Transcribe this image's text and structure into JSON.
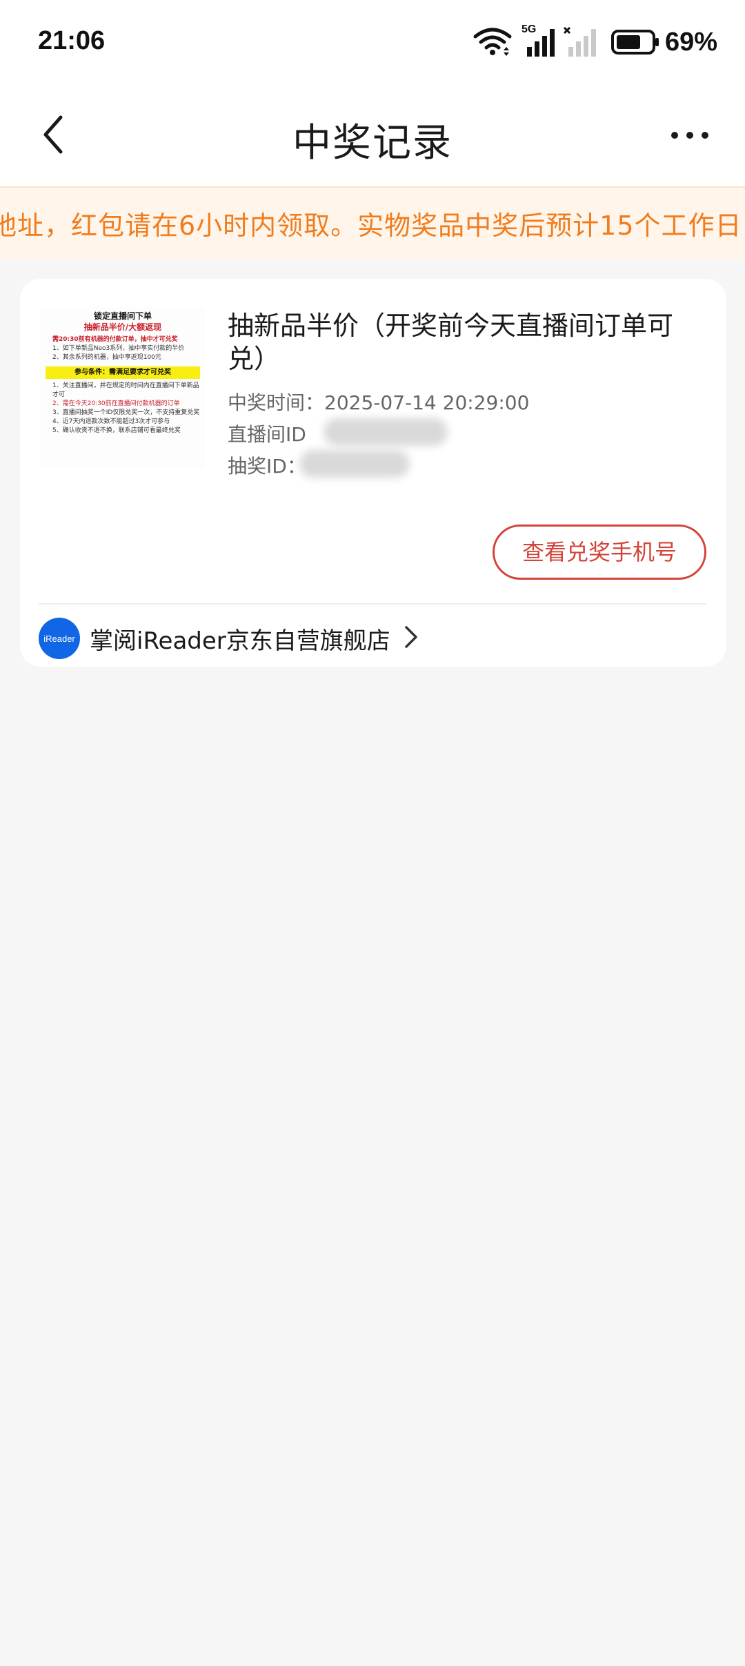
{
  "status_bar": {
    "time": "21:06",
    "battery_percent": "69%",
    "network_label": "5G",
    "icons": [
      "wifi-icon",
      "signal-5g-icon",
      "signal-no-service-icon",
      "battery-icon"
    ]
  },
  "navbar": {
    "title": "中奖记录",
    "back_icon": "chevron-left-icon",
    "more_icon": "more-dots-icon"
  },
  "notice": {
    "text": "地址，红包请在6小时内领取。实物奖品中奖后预计15个工作日"
  },
  "prize_card": {
    "thumbnail": {
      "title": "锁定直播间下单",
      "subtitle": "抽新品半价/大额返现",
      "rule_red": "需20:30前有机器的付款订单，抽中才可兑奖",
      "items": [
        "1、如下单新品Neo3系列，抽中享实付款的半价",
        "2、其余系列的机器，抽中享返现100元"
      ],
      "condition_banner": "参与条件：需满足要求才可兑奖",
      "conditions": [
        "1、关注直播间，并在规定的时间内在直播间下单新品才可",
        "2、需在今天20:30前在直播间付款机器的订单",
        "3、直播间抽奖一个ID仅限兑奖一次，不支持重复兑奖",
        "4、近7天内退款次数不能超过3次才可参与",
        "5、确认收货不退不换，联系店铺可看最终兑奖"
      ]
    },
    "title": "抽新品半价（开奖前今天直播间订单可兑）",
    "win_time_label": "中奖时间：",
    "win_time": "2025-07-14 20:29:00",
    "live_room_label": "直播间ID",
    "lottery_label": "抽奖ID：",
    "claim_button": "查看兑奖手机号",
    "shop": {
      "logo_text": "iReader",
      "name": "掌阅iReader京东自营旗舰店",
      "chevron_icon": "chevron-right-icon"
    }
  },
  "colors": {
    "accent_red": "#d44337",
    "notice_orange": "#f07c1e",
    "notice_bg": "#fff5ea",
    "page_bg": "#f6f6f6",
    "shop_logo_blue": "#1166e6"
  }
}
